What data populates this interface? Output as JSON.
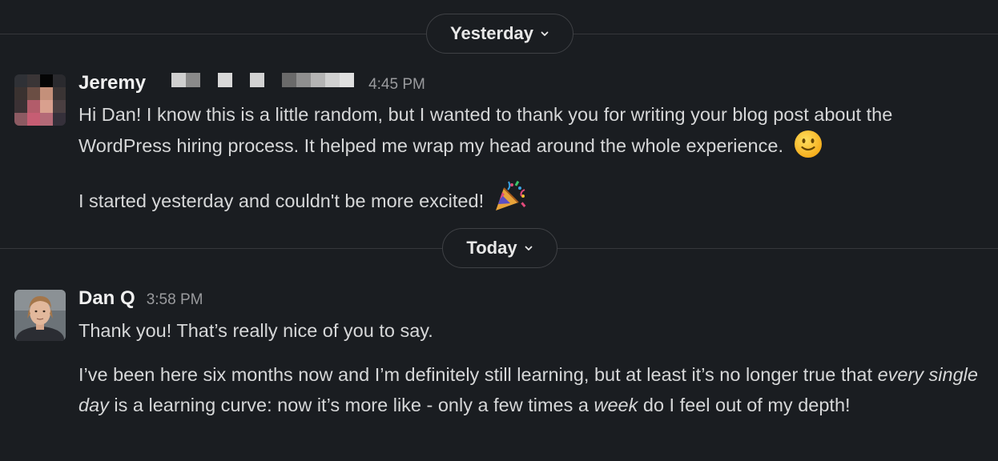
{
  "dividers": {
    "yesterday": {
      "label": "Yesterday"
    },
    "today": {
      "label": "Today"
    }
  },
  "messages": [
    {
      "author": "Jeremy",
      "time": "4:45 PM",
      "redacted_name": true,
      "paragraphs": [
        "Hi Dan! I know this is a little random, but I wanted to thank you for writing your blog post about the WordPress hiring process. It helped me wrap my head around the whole experience.",
        "I started yesterday and couldn't be more excited!"
      ],
      "emojis": [
        "slightly-smiling-face",
        "party-popper"
      ]
    },
    {
      "author": "Dan Q",
      "time": "3:58 PM",
      "paragraphs": [
        "Thank you! That’s really nice of you to say."
      ],
      "rich_paragraph": {
        "part1": "I’ve been here six months now and I’m definitely still learning, but at least it’s no longer true that ",
        "em1": "every single day",
        "part2": " is a learning curve: now it’s more like - only a few times a ",
        "em2": "week",
        "part3": " do I feel out of my depth!"
      }
    }
  ],
  "colors": {
    "background": "#1a1d21",
    "divider": "#35373b",
    "text": "#d6d7d8",
    "timestamp": "#9a9b9e"
  }
}
